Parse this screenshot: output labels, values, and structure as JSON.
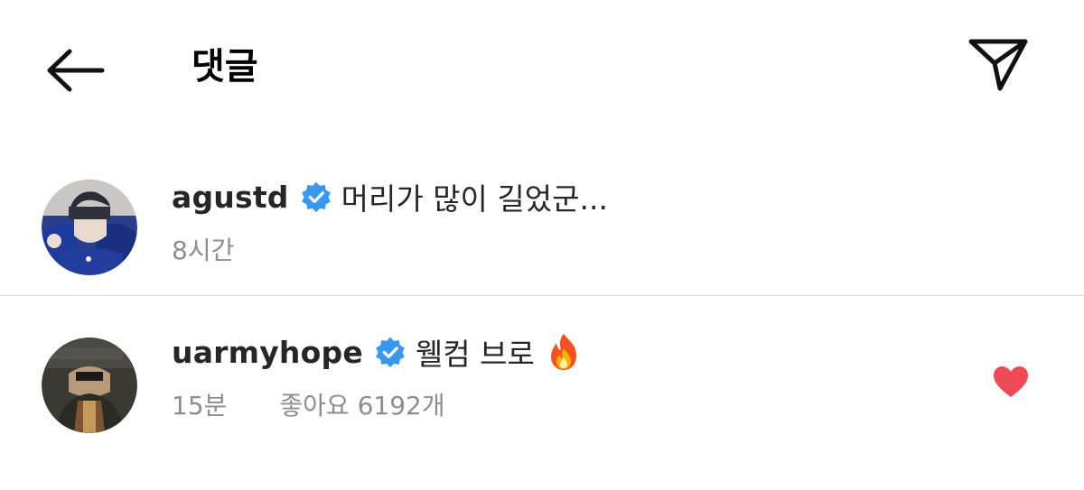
{
  "header": {
    "title": "댓글",
    "back_icon": "arrow-left-icon",
    "send_icon": "paper-plane-icon"
  },
  "comments": [
    {
      "username": "agustd",
      "verified": true,
      "text": "머리가 많이 길었군...",
      "time": "8시간",
      "avatar_icon": "avatar-photo"
    },
    {
      "username": "uarmyhope",
      "verified": true,
      "text": "웰컴 브로",
      "emoji": "fire-emoji",
      "time": "15분",
      "likes": "좋아요 6192개",
      "liked": true,
      "avatar_icon": "avatar-photo"
    }
  ],
  "colors": {
    "verified_blue": "#3897f0",
    "like_red": "#ed4956",
    "meta_gray": "#8e8e8e",
    "divider": "#dbdbdb"
  }
}
